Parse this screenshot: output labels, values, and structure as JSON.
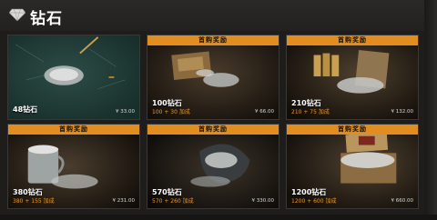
{
  "header": {
    "title": "钻石",
    "icon": "diamond-icon"
  },
  "offers": [
    {
      "ribbon": "",
      "amount": "48钻石",
      "bonus": "",
      "price": "¥ 33.00"
    },
    {
      "ribbon": "首购奖励",
      "amount": "100钻石",
      "bonus": "100 + 30 加成",
      "price": "¥ 66.00"
    },
    {
      "ribbon": "首购奖励",
      "amount": "210钻石",
      "bonus": "210 + 75 加成",
      "price": "¥ 132.00"
    },
    {
      "ribbon": "首购奖励",
      "amount": "380钻石",
      "bonus": "380 + 155 加成",
      "price": "¥ 231.00"
    },
    {
      "ribbon": "首购奖励",
      "amount": "570钻石",
      "bonus": "570 + 260 加成",
      "price": "¥ 330.00"
    },
    {
      "ribbon": "首购奖励",
      "amount": "1200钻石",
      "bonus": "1200 + 600 加成",
      "price": "¥ 660.00"
    }
  ],
  "colors": {
    "ribbon": "#e28d1f",
    "bonus_text": "#e8962a",
    "background": "#1e1d1b"
  }
}
